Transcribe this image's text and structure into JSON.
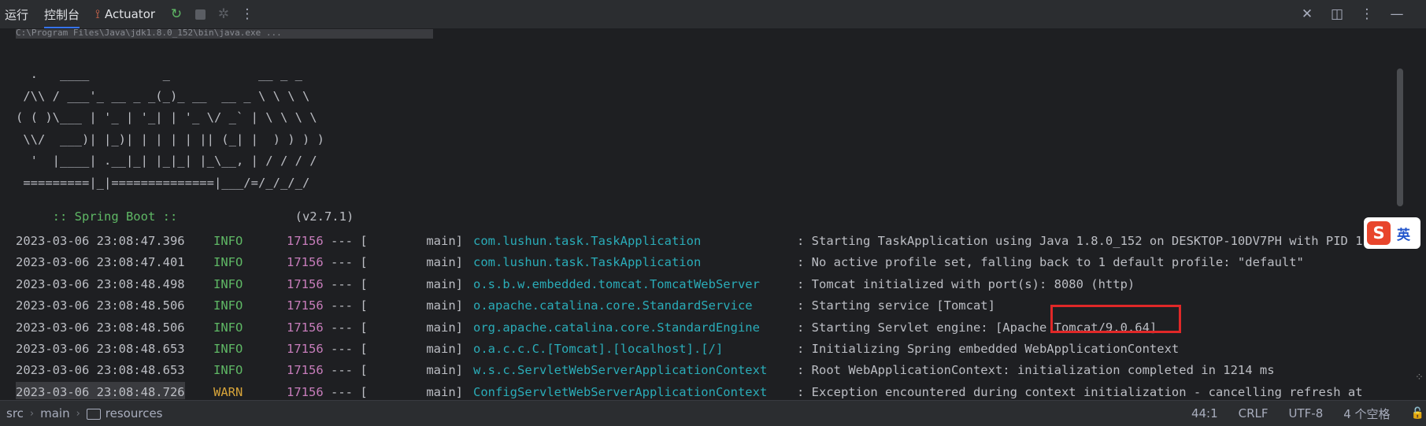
{
  "toolbar": {
    "tab_run": "运行",
    "tab_console": "控制台",
    "tab_actuator": "Actuator",
    "icons": [
      "rerun-icon",
      "stop-icon",
      "debug-icon",
      "more-vertical-icon"
    ],
    "right_icons": [
      "close-icon",
      "layout-icon",
      "more-vertical-icon",
      "minimize-icon"
    ]
  },
  "console": {
    "command_line": "C:\\Program Files\\Java\\jdk1.8.0_152\\bin\\java.exe ...",
    "banner": "  .   ____          _            __ _ _\n /\\\\ / ___'_ __ _ _(_)_ __  __ _ \\ \\ \\ \\\n( ( )\\___ | '_ | '_| | '_ \\/ _` | \\ \\ \\ \\\n \\\\/  ___)| |_)| | | | | || (_| |  ) ) ) )\n  '  |____| .__|_| |_|_| |_\\__, | / / / /\n =========|_|==============|___/=/_/_/_/",
    "spring_label": " :: Spring Boot :: ",
    "spring_version": "               (v2.7.1)",
    "logs": [
      {
        "date": "2023-03-06 23:08:47.396",
        "level": "INFO",
        "pid": "17156",
        "sep": "--- [",
        "thread": "main]",
        "logger": "com.lushun.task.TaskApplication",
        "message": ": Starting TaskApplication using Java 1.8.0_152 on DESKTOP-10DV7PH with PID 1"
      },
      {
        "date": "2023-03-06 23:08:47.401",
        "level": "INFO",
        "pid": "17156",
        "sep": "--- [",
        "thread": "main]",
        "logger": "com.lushun.task.TaskApplication",
        "message": ": No active profile set, falling back to 1 default profile: \"default\""
      },
      {
        "date": "2023-03-06 23:08:48.498",
        "level": "INFO",
        "pid": "17156",
        "sep": "--- [",
        "thread": "main]",
        "logger": "o.s.b.w.embedded.tomcat.TomcatWebServer",
        "message": ": Tomcat initialized with port(s): 8080 (http)"
      },
      {
        "date": "2023-03-06 23:08:48.506",
        "level": "INFO",
        "pid": "17156",
        "sep": "--- [",
        "thread": "main]",
        "logger": "o.apache.catalina.core.StandardService",
        "message": ": Starting service [Tomcat]"
      },
      {
        "date": "2023-03-06 23:08:48.506",
        "level": "INFO",
        "pid": "17156",
        "sep": "--- [",
        "thread": "main]",
        "logger": "org.apache.catalina.core.StandardEngine",
        "message": ": Starting Servlet engine: [Apache Tomcat/9.0.64]"
      },
      {
        "date": "2023-03-06 23:08:48.653",
        "level": "INFO",
        "pid": "17156",
        "sep": "--- [",
        "thread": "main]",
        "logger": "o.a.c.c.C.[Tomcat].[localhost].[/]",
        "message": ": Initializing Spring embedded WebApplicationContext"
      },
      {
        "date": "2023-03-06 23:08:48.653",
        "level": "INFO",
        "pid": "17156",
        "sep": "--- [",
        "thread": "main]",
        "logger": "w.s.c.ServletWebServerApplicationContext",
        "message": ": Root WebApplicationContext: initialization completed in 1214 ms"
      },
      {
        "date": "2023-03-06 23:08:48.726",
        "level": "WARN",
        "pid": "17156",
        "sep": "--- [",
        "thread": "main]",
        "logger": "ConfigServletWebServerApplicationContext",
        "message": ": Exception encountered during context initialization - cancelling refresh at"
      }
    ]
  },
  "ime": {
    "logo": "S",
    "mode": "英"
  },
  "statusbar": {
    "breadcrumb": [
      "src",
      "main",
      "resources"
    ],
    "position": "44:1",
    "line_ending": "CRLF",
    "encoding": "UTF-8",
    "indent": "4 个空格"
  },
  "colors": {
    "info": "#5fb865",
    "warn": "#d7a43a",
    "pid": "#c77dbb",
    "logger": "#2aacb8",
    "highlight": "#e02828"
  }
}
